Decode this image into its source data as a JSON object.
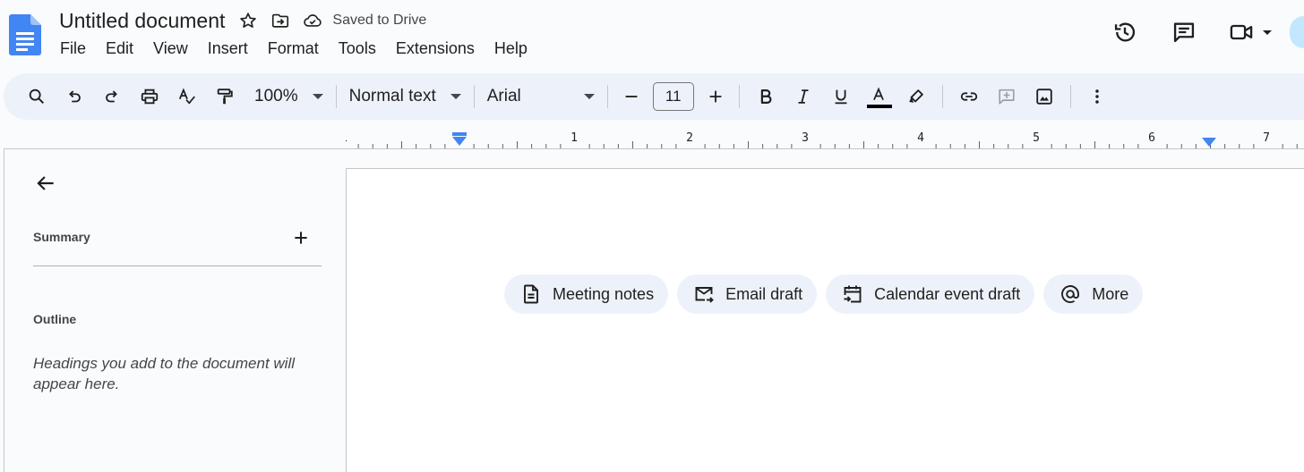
{
  "document": {
    "title": "Untitled document",
    "save_status": "Saved to Drive"
  },
  "menu": [
    "File",
    "Edit",
    "View",
    "Insert",
    "Format",
    "Tools",
    "Extensions",
    "Help"
  ],
  "toolbar": {
    "zoom": "100%",
    "style": "Normal text",
    "font": "Arial",
    "font_size": "11",
    "text_color": "#000000"
  },
  "ruler": {
    "labels": [
      "1",
      "1",
      "2",
      "3",
      "4",
      "5",
      "6",
      "7"
    ],
    "marker_color": "#4285f4"
  },
  "sidebar": {
    "summary_label": "Summary",
    "outline_label": "Outline",
    "outline_hint": "Headings you add to the document will appear here."
  },
  "chips": [
    {
      "label": "Meeting notes",
      "icon": "document-icon"
    },
    {
      "label": "Email draft",
      "icon": "email-forward-icon"
    },
    {
      "label": "Calendar event draft",
      "icon": "calendar-icon"
    },
    {
      "label": "More",
      "icon": "at-sign-icon"
    }
  ],
  "colors": {
    "brand_blue": "#4285f4",
    "toolbar_bg": "#edf2fa",
    "chip_bg": "#edf2fa",
    "page_bg": "#ffffff",
    "app_bg": "#f9fbfd"
  }
}
